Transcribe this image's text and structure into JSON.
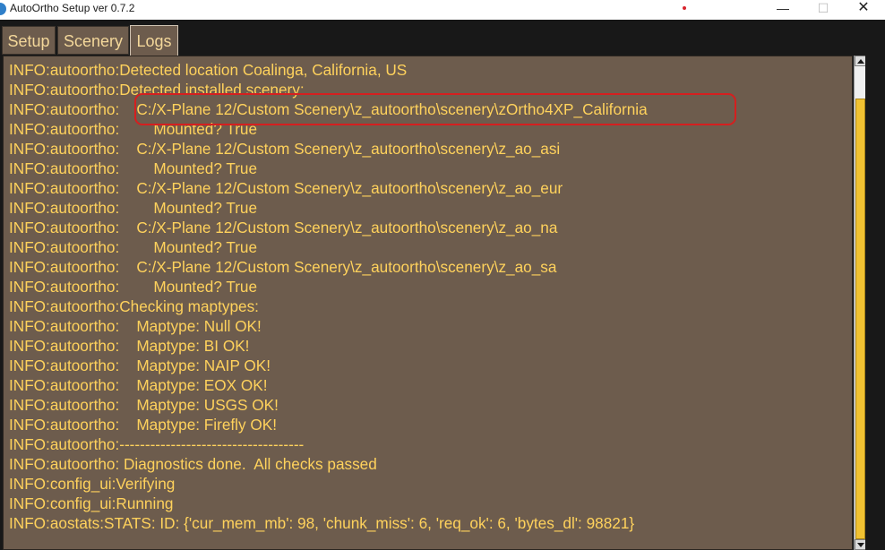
{
  "window": {
    "title": "AutoOrtho Setup ver 0.7.2",
    "minimize_glyph": "—",
    "maximize_glyph": "☐",
    "close_glyph": "✕"
  },
  "tabs": [
    {
      "label": "Setup",
      "selected": false
    },
    {
      "label": "Scenery",
      "selected": false
    },
    {
      "label": "Logs",
      "selected": true
    }
  ],
  "log": {
    "lines": [
      "INFO:autoortho:Detected location Coalinga, California, US",
      "INFO:autoortho:Detected installed scenery:",
      "INFO:autoortho:    C:/X-Plane 12/Custom Scenery\\z_autoortho\\scenery\\zOrtho4XP_California",
      "INFO:autoortho:        Mounted? True",
      "INFO:autoortho:    C:/X-Plane 12/Custom Scenery\\z_autoortho\\scenery\\z_ao_asi",
      "INFO:autoortho:        Mounted? True",
      "INFO:autoortho:    C:/X-Plane 12/Custom Scenery\\z_autoortho\\scenery\\z_ao_eur",
      "INFO:autoortho:        Mounted? True",
      "INFO:autoortho:    C:/X-Plane 12/Custom Scenery\\z_autoortho\\scenery\\z_ao_na",
      "INFO:autoortho:        Mounted? True",
      "INFO:autoortho:    C:/X-Plane 12/Custom Scenery\\z_autoortho\\scenery\\z_ao_sa",
      "INFO:autoortho:        Mounted? True",
      "INFO:autoortho:Checking maptypes:",
      "INFO:autoortho:    Maptype: Null OK!",
      "INFO:autoortho:    Maptype: BI OK!",
      "INFO:autoortho:    Maptype: NAIP OK!",
      "INFO:autoortho:    Maptype: EOX OK!",
      "INFO:autoortho:    Maptype: USGS OK!",
      "INFO:autoortho:    Maptype: Firefly OK!",
      "INFO:autoortho:------------------------------------",
      "INFO:autoortho: Diagnostics done.  All checks passed",
      "INFO:config_ui:Verifying",
      "INFO:config_ui:Running",
      "INFO:aostats:STATS: ID: {'cur_mem_mb': 98, 'chunk_miss': 6, 'req_ok': 6, 'bytes_dl': 98821}"
    ],
    "highlighted_line_index": 2,
    "scroll_position": 1.0
  },
  "colors": {
    "log_background": "#6d5c4d",
    "log_text": "#ffd25c",
    "highlight_border": "#d51f1f",
    "scrollbar_thumb": "#f1c232",
    "frame_background": "#181818"
  },
  "icons": {
    "app": "autoortho-app-icon",
    "minimize": "minimize-icon",
    "maximize": "maximize-icon",
    "close": "close-icon"
  }
}
